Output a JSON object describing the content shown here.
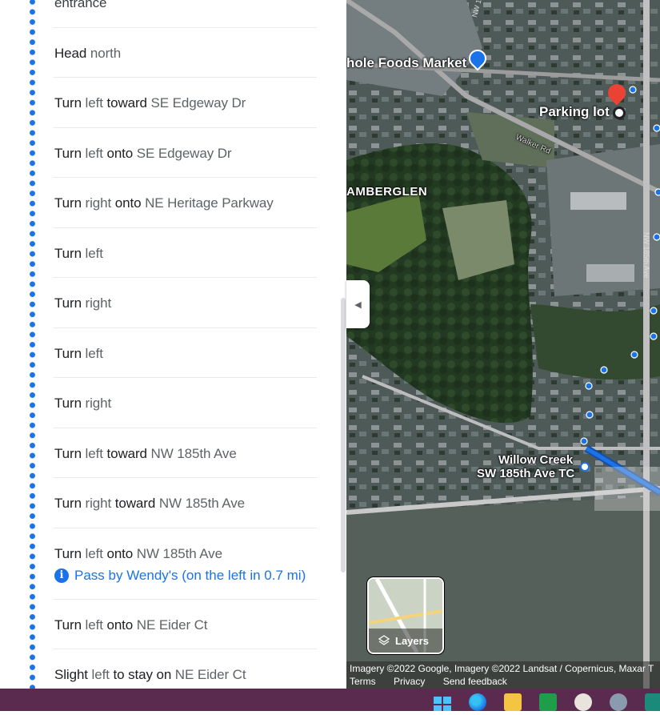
{
  "directions": {
    "top_partial": "entrance",
    "steps": [
      {
        "parts": [
          {
            "t": "Head",
            "s": "b"
          },
          {
            "t": " north",
            "s": "n"
          }
        ]
      },
      {
        "parts": [
          {
            "t": "Turn",
            "s": "b"
          },
          {
            "t": " left ",
            "s": "n"
          },
          {
            "t": "toward",
            "s": "b"
          },
          {
            "t": " SE Edgeway Dr",
            "s": "n"
          }
        ]
      },
      {
        "parts": [
          {
            "t": "Turn",
            "s": "b"
          },
          {
            "t": " left ",
            "s": "n"
          },
          {
            "t": "onto",
            "s": "b"
          },
          {
            "t": " SE Edgeway Dr",
            "s": "n"
          }
        ]
      },
      {
        "parts": [
          {
            "t": "Turn",
            "s": "b"
          },
          {
            "t": " right ",
            "s": "n"
          },
          {
            "t": "onto",
            "s": "b"
          },
          {
            "t": " NE Heritage Parkway",
            "s": "n"
          }
        ]
      },
      {
        "parts": [
          {
            "t": "Turn",
            "s": "b"
          },
          {
            "t": " left",
            "s": "n"
          }
        ]
      },
      {
        "parts": [
          {
            "t": "Turn",
            "s": "b"
          },
          {
            "t": " right",
            "s": "n"
          }
        ]
      },
      {
        "parts": [
          {
            "t": "Turn",
            "s": "b"
          },
          {
            "t": " left",
            "s": "n"
          }
        ]
      },
      {
        "parts": [
          {
            "t": "Turn",
            "s": "b"
          },
          {
            "t": " right",
            "s": "n"
          }
        ]
      },
      {
        "parts": [
          {
            "t": "Turn",
            "s": "b"
          },
          {
            "t": " left ",
            "s": "n"
          },
          {
            "t": "toward",
            "s": "b"
          },
          {
            "t": " NW 185th Ave",
            "s": "n"
          }
        ]
      },
      {
        "parts": [
          {
            "t": "Turn",
            "s": "b"
          },
          {
            "t": " right ",
            "s": "n"
          },
          {
            "t": "toward",
            "s": "b"
          },
          {
            "t": " NW 185th Ave",
            "s": "n"
          }
        ]
      },
      {
        "parts": [
          {
            "t": "Turn",
            "s": "b"
          },
          {
            "t": " left ",
            "s": "n"
          },
          {
            "t": "onto",
            "s": "b"
          },
          {
            "t": " NW 185th Ave",
            "s": "n"
          }
        ],
        "note": "Pass by Wendy's (on the left in 0.7 mi)"
      },
      {
        "parts": [
          {
            "t": "Turn",
            "s": "b"
          },
          {
            "t": " left ",
            "s": "n"
          },
          {
            "t": "onto",
            "s": "b"
          },
          {
            "t": " NE Eider Ct",
            "s": "n"
          }
        ]
      },
      {
        "parts": [
          {
            "t": "Slight",
            "s": "b"
          },
          {
            "t": " left ",
            "s": "n"
          },
          {
            "t": "to stay on",
            "s": "b"
          },
          {
            "t": " NE Eider Ct",
            "s": "n"
          }
        ]
      }
    ]
  },
  "map": {
    "labels": {
      "whole_foods": "hole Foods Market",
      "parking_lot": "Parking lot",
      "walker_rd": "Walker Rd",
      "tamberglen": "AMBERGLEN",
      "willow_creek_1": "Willow Creek",
      "willow_creek_2": "SW 185th Ave TC",
      "road_label_top": "NW 185th Ave",
      "road_label_side": "NW 185th Ave"
    },
    "layers_label": "Layers",
    "attribution": "Imagery ©2022 Google, Imagery ©2022 Landsat / Copernicus, Maxar T",
    "links": {
      "terms": "Terms",
      "privacy": "Privacy",
      "feedback": "Send feedback"
    }
  },
  "colors": {
    "route_blue": "#1a73e8",
    "pin_red": "#ea4335",
    "taskbar": "#5b2b4f"
  },
  "icons": {
    "collapse": "chevron-left-icon",
    "layers": "layers-icon",
    "info": "info-icon",
    "pin": "map-pin-icon"
  }
}
